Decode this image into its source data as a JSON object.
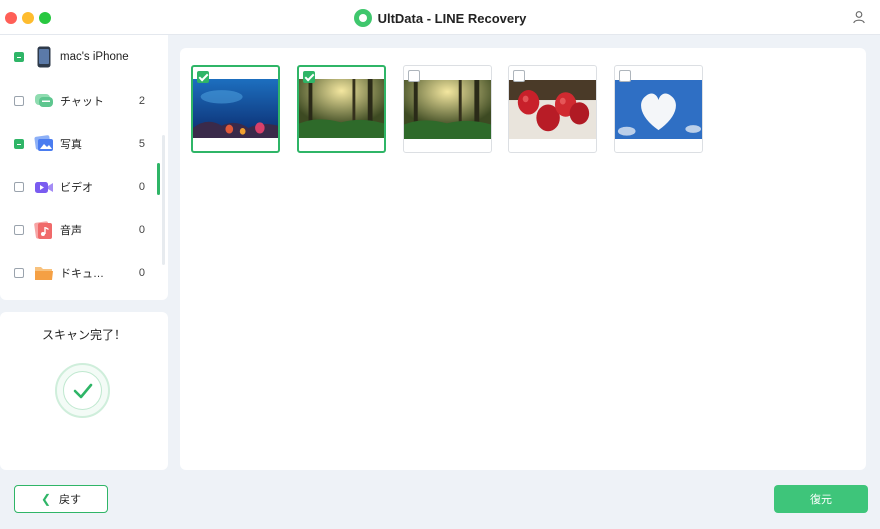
{
  "window": {
    "title": "UltData - LINE Recovery"
  },
  "sidebar": {
    "device_name": "mac's iPhone",
    "items": [
      {
        "label": "チャット",
        "count": "2",
        "icon": "chat-icon",
        "color": "#5ec68f"
      },
      {
        "label": "写真",
        "count": "5",
        "icon": "photo-icon",
        "color": "#4a7cf0"
      },
      {
        "label": "ビデオ",
        "count": "0",
        "icon": "video-icon",
        "color": "#7a5cf0"
      },
      {
        "label": "音声",
        "count": "0",
        "icon": "audio-icon",
        "color": "#f06a6a"
      },
      {
        "label": "ドキュ…",
        "count": "0",
        "icon": "folder-icon",
        "color": "#f5a044"
      }
    ]
  },
  "scan": {
    "status": "スキャン完了！"
  },
  "photos": [
    {
      "name": "ocean-reef",
      "selected": true
    },
    {
      "name": "forest-sunlight",
      "selected": true
    },
    {
      "name": "forest-sunlight",
      "selected": false
    },
    {
      "name": "strawberries",
      "selected": false
    },
    {
      "name": "heart-cloud",
      "selected": false
    }
  ],
  "footer": {
    "back_label": "戻す",
    "recover_label": "復元"
  },
  "colors": {
    "accent": "#2fb567",
    "button": "#3ec57a"
  }
}
